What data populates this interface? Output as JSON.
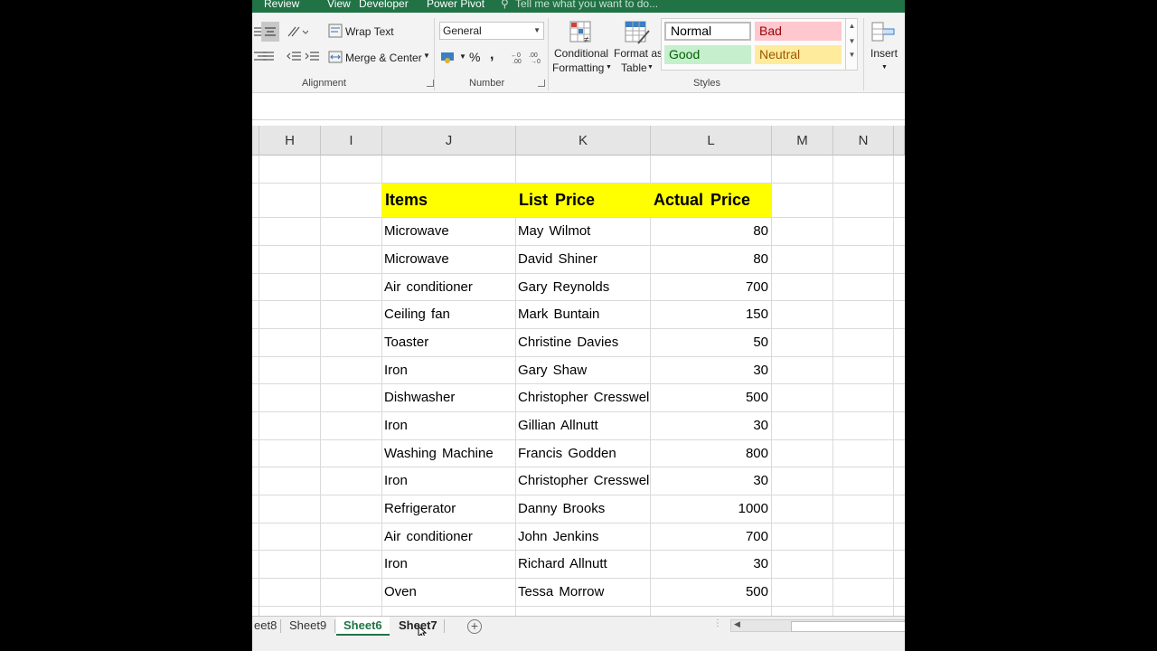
{
  "menu": {
    "review": "Review",
    "view": "View",
    "developer": "Developer",
    "power_pivot": "Power Pivot",
    "tell_me": "Tell me what you want to do..."
  },
  "ribbon": {
    "alignment": {
      "wrap_text": "Wrap Text",
      "merge_center": "Merge & Center",
      "label": "Alignment"
    },
    "number": {
      "format_value": "General",
      "percent": "%",
      "comma": ",",
      "label": "Number"
    },
    "styles": {
      "conditional_formatting": "Conditional Formatting",
      "cf_line1": "Conditional",
      "cf_line2": "Formatting",
      "format_table_line1": "Format as",
      "format_table_line2": "Table",
      "normal": "Normal",
      "bad": "Bad",
      "good": "Good",
      "neutral": "Neutral",
      "label": "Styles",
      "colors": {
        "bad_bg": "#ffc7ce",
        "good_bg": "#c6efce",
        "neutral_bg": "#ffeb9c"
      }
    },
    "cells": {
      "insert": "Insert"
    }
  },
  "columns": [
    "H",
    "I",
    "J",
    "K",
    "L",
    "M",
    "N"
  ],
  "table": {
    "headers": [
      "Items",
      "List Price",
      "Actual Price"
    ],
    "header_fill": "#ffff00",
    "rows": [
      [
        "Microwave",
        "May  Wilmot",
        "80"
      ],
      [
        "Microwave",
        "David  Shiner",
        "80"
      ],
      [
        "Air  conditioner",
        "Gary  Reynolds",
        "700"
      ],
      [
        "Ceiling  fan",
        "Mark  Buntain",
        "150"
      ],
      [
        "Toaster",
        "Christine  Davies",
        "50"
      ],
      [
        "Iron",
        "Gary  Shaw",
        "30"
      ],
      [
        "Dishwasher",
        "Christopher  Cresswell",
        "500"
      ],
      [
        "Iron",
        "Gillian  Allnutt",
        "30"
      ],
      [
        "Washing  Machine",
        "Francis  Godden",
        "800"
      ],
      [
        "Iron",
        "Christopher  Cresswell",
        "30"
      ],
      [
        "Refrigerator",
        "Danny  Brooks",
        "1000"
      ],
      [
        "Air  conditioner",
        "John  Jenkins",
        "700"
      ],
      [
        "Iron",
        "Richard  Allnutt",
        "30"
      ],
      [
        "Oven",
        "Tessa  Morrow",
        "500"
      ]
    ]
  },
  "sheet_tabs": [
    "eet8",
    "Sheet9",
    "Sheet6",
    "Sheet7"
  ],
  "active_sheet": "Sheet6",
  "accent_color": "#217346"
}
